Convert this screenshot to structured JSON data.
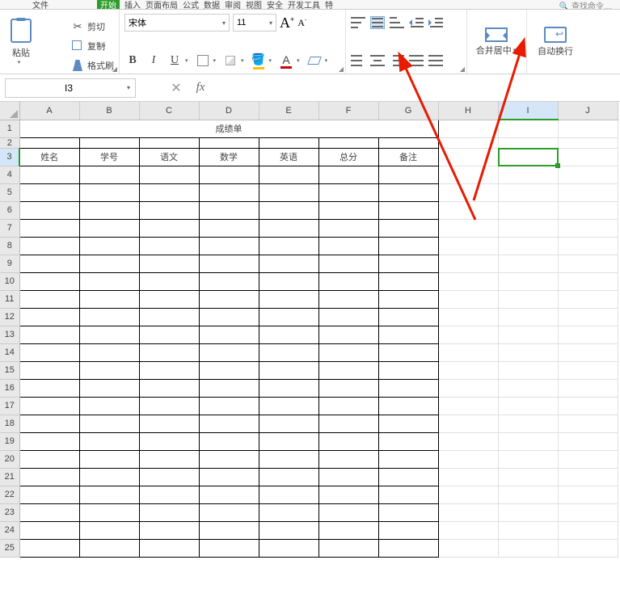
{
  "menu": {
    "file": "文件",
    "tabs": [
      "开始",
      "插入",
      "页面布局",
      "公式",
      "数据",
      "审阅",
      "视图",
      "安全",
      "开发工具",
      "特"
    ],
    "active_index": 0,
    "search_placeholder": "查找命令…"
  },
  "ribbon": {
    "paste": {
      "paste": "粘贴",
      "cut": "剪切",
      "copy": "复制",
      "format_painter": "格式刷"
    },
    "font": {
      "name": "宋体",
      "size": "11"
    },
    "merge": {
      "label": "合并居中"
    },
    "wrap": {
      "label": "自动换行"
    }
  },
  "namebox": {
    "value": "I3"
  },
  "columns": [
    "A",
    "B",
    "C",
    "D",
    "E",
    "F",
    "G",
    "H",
    "I",
    "J"
  ],
  "rows": [
    "1",
    "2",
    "3",
    "4",
    "5",
    "6",
    "7",
    "8",
    "9",
    "10",
    "11",
    "12",
    "13",
    "14",
    "15",
    "16",
    "17",
    "18",
    "19",
    "20",
    "21",
    "22",
    "23",
    "24",
    "25"
  ],
  "sheet": {
    "title": "成绩单",
    "headers": [
      "姓名",
      "学号",
      "语文",
      "数学",
      "英语",
      "总分",
      "备注"
    ]
  },
  "active_cell": {
    "col": "I",
    "row": 3
  }
}
